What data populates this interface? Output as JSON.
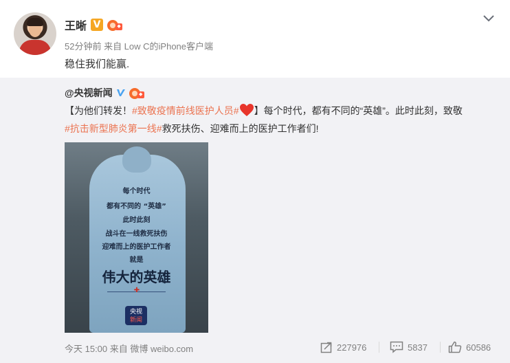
{
  "post": {
    "username": "王晰",
    "verified_badge": "V",
    "meta": "52分钟前 来自 Low C的iPhone客户端",
    "text": "稳住我们能赢."
  },
  "retweet": {
    "author": "@央视新闻",
    "text_parts": {
      "p1": "【为他们转发！",
      "topic1": "#致敬疫情前线医护人员#",
      "p2": "】每个时代，都有不同的“英雄”。此时此刻，致敬",
      "topic2": "#抗击新型肺炎第一线#",
      "p3": "救死扶伤、迎难而上的医护工作者们!"
    },
    "image_text": {
      "line1": "每个时代",
      "line2": "都有不同的 “英雄”",
      "line3": "此时此刻",
      "line4": "战斗在一线救死扶伤",
      "line5": "迎难而上的医护工作者",
      "line6": "就是",
      "headline": "伟大的英雄",
      "logo_top": "央视",
      "logo_bottom": "新闻"
    },
    "footer": {
      "time_source": "今天 15:00 来自 微博 weibo.com",
      "shares": "227976",
      "comments": "5837",
      "likes": "60586"
    }
  },
  "icons": {
    "expand": "chevron-down-icon",
    "share": "share-icon",
    "comment": "comment-icon",
    "like": "thumbs-up-icon"
  },
  "colors": {
    "topic": "#eb7350",
    "verified_gold": "#f5a623",
    "verified_blue": "#4aa3f0",
    "retweet_bg": "#f2f2f5"
  }
}
